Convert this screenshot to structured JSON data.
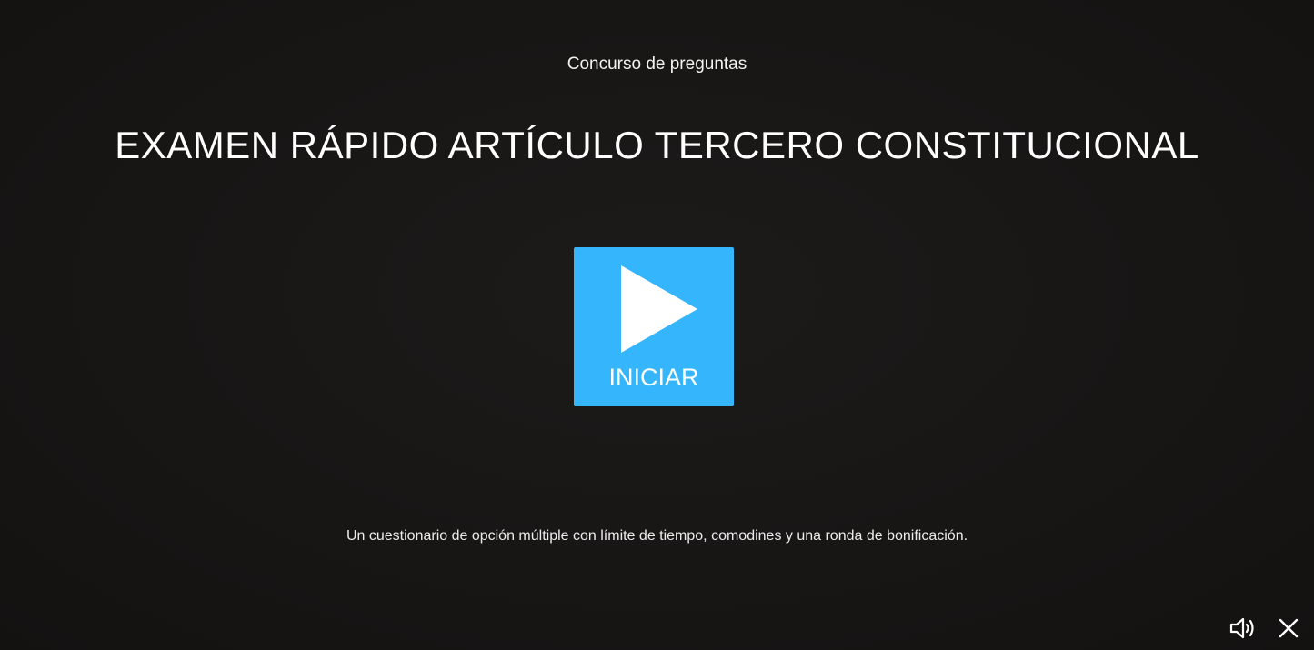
{
  "header": {
    "activity_type": "Concurso de preguntas",
    "title": "EXAMEN RÁPIDO ARTÍCULO TERCERO CONSTITUCIONAL"
  },
  "start_button": {
    "label": "INICIAR",
    "icon": "play-icon",
    "color": "#35b5fb"
  },
  "description": "Un cuestionario de opción múltiple con límite de tiempo, comodines y una ronda de bonificación.",
  "controls": {
    "sound_icon": "speaker-icon",
    "close_icon": "close-icon"
  },
  "colors": {
    "background": "#181615",
    "text": "#ffffff",
    "accent": "#35b5fb"
  }
}
